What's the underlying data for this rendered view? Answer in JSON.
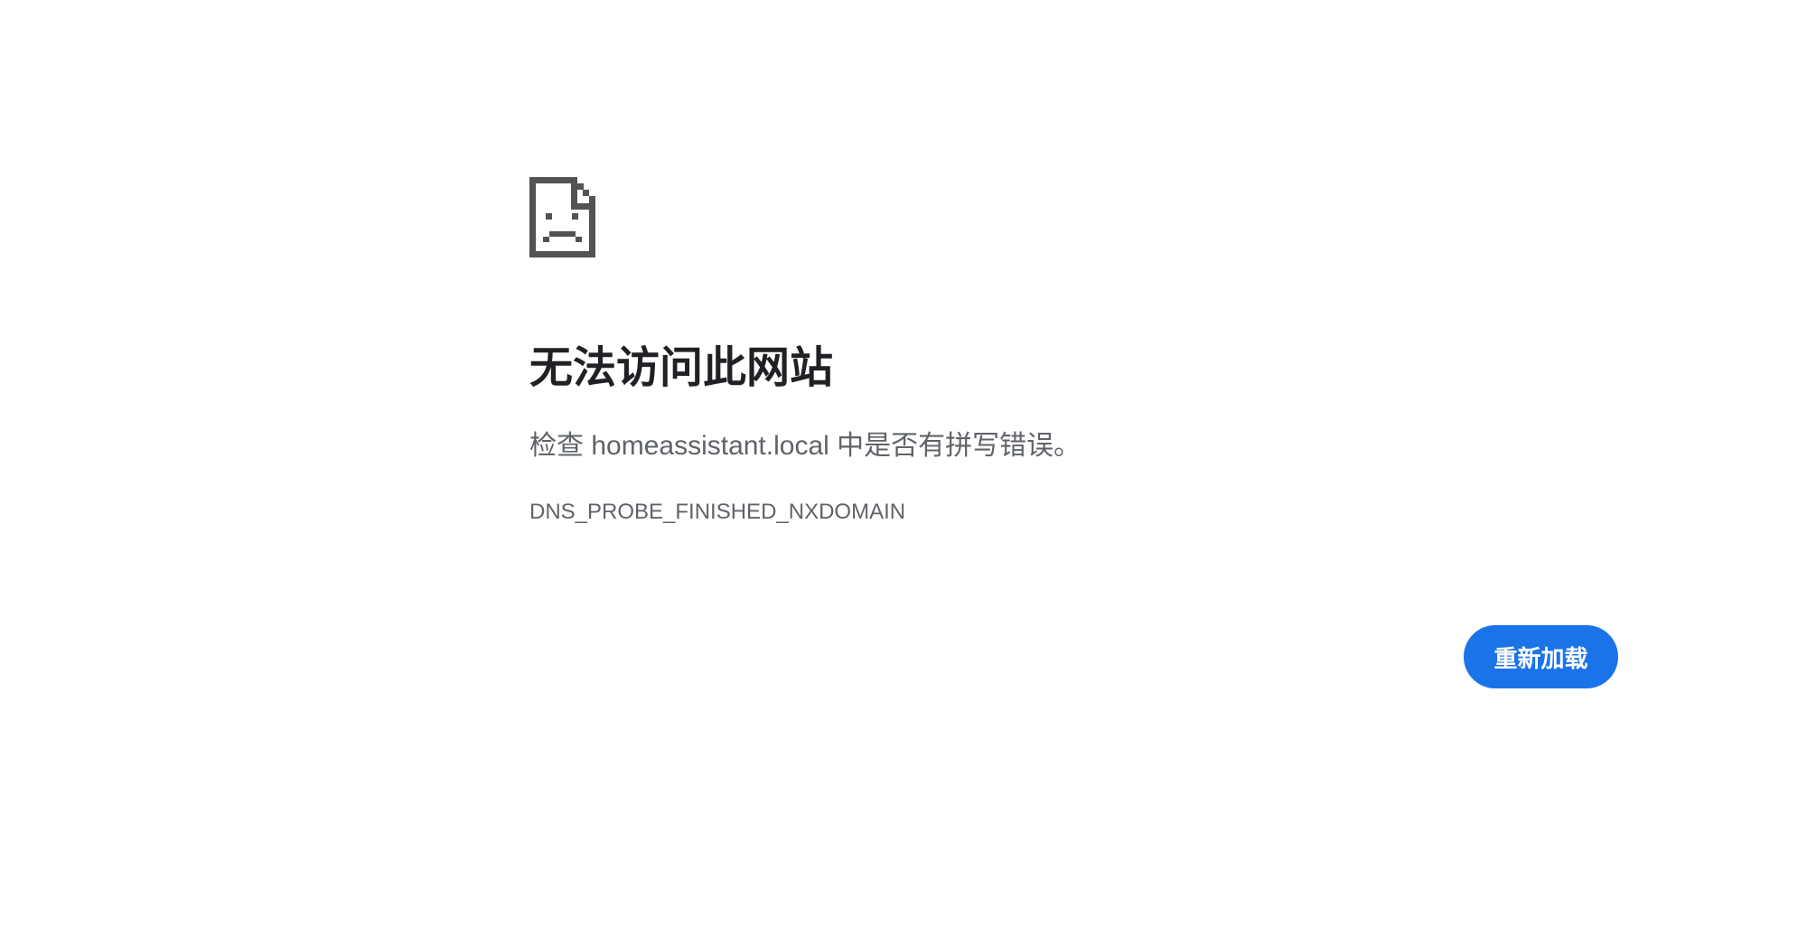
{
  "error": {
    "icon": "sad-page-icon",
    "title": "无法访问此网站",
    "summary": "检查 homeassistant.local 中是否有拼写错误。",
    "code": "DNS_PROBE_FINISHED_NXDOMAIN"
  },
  "actions": {
    "reload_label": "重新加载"
  },
  "colors": {
    "background": "#ffffff",
    "title": "#202124",
    "secondary_text": "#5f6368",
    "icon": "#535353",
    "button": "#1a73e8",
    "button_text": "#ffffff"
  }
}
